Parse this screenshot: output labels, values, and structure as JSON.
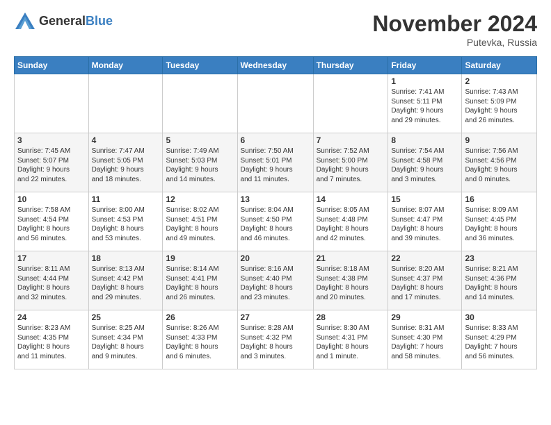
{
  "header": {
    "logo_general": "General",
    "logo_blue": "Blue",
    "month_title": "November 2024",
    "location": "Putevka, Russia"
  },
  "weekdays": [
    "Sunday",
    "Monday",
    "Tuesday",
    "Wednesday",
    "Thursday",
    "Friday",
    "Saturday"
  ],
  "weeks": [
    [
      {
        "day": "",
        "info": ""
      },
      {
        "day": "",
        "info": ""
      },
      {
        "day": "",
        "info": ""
      },
      {
        "day": "",
        "info": ""
      },
      {
        "day": "",
        "info": ""
      },
      {
        "day": "1",
        "info": "Sunrise: 7:41 AM\nSunset: 5:11 PM\nDaylight: 9 hours\nand 29 minutes."
      },
      {
        "day": "2",
        "info": "Sunrise: 7:43 AM\nSunset: 5:09 PM\nDaylight: 9 hours\nand 26 minutes."
      }
    ],
    [
      {
        "day": "3",
        "info": "Sunrise: 7:45 AM\nSunset: 5:07 PM\nDaylight: 9 hours\nand 22 minutes."
      },
      {
        "day": "4",
        "info": "Sunrise: 7:47 AM\nSunset: 5:05 PM\nDaylight: 9 hours\nand 18 minutes."
      },
      {
        "day": "5",
        "info": "Sunrise: 7:49 AM\nSunset: 5:03 PM\nDaylight: 9 hours\nand 14 minutes."
      },
      {
        "day": "6",
        "info": "Sunrise: 7:50 AM\nSunset: 5:01 PM\nDaylight: 9 hours\nand 11 minutes."
      },
      {
        "day": "7",
        "info": "Sunrise: 7:52 AM\nSunset: 5:00 PM\nDaylight: 9 hours\nand 7 minutes."
      },
      {
        "day": "8",
        "info": "Sunrise: 7:54 AM\nSunset: 4:58 PM\nDaylight: 9 hours\nand 3 minutes."
      },
      {
        "day": "9",
        "info": "Sunrise: 7:56 AM\nSunset: 4:56 PM\nDaylight: 9 hours\nand 0 minutes."
      }
    ],
    [
      {
        "day": "10",
        "info": "Sunrise: 7:58 AM\nSunset: 4:54 PM\nDaylight: 8 hours\nand 56 minutes."
      },
      {
        "day": "11",
        "info": "Sunrise: 8:00 AM\nSunset: 4:53 PM\nDaylight: 8 hours\nand 53 minutes."
      },
      {
        "day": "12",
        "info": "Sunrise: 8:02 AM\nSunset: 4:51 PM\nDaylight: 8 hours\nand 49 minutes."
      },
      {
        "day": "13",
        "info": "Sunrise: 8:04 AM\nSunset: 4:50 PM\nDaylight: 8 hours\nand 46 minutes."
      },
      {
        "day": "14",
        "info": "Sunrise: 8:05 AM\nSunset: 4:48 PM\nDaylight: 8 hours\nand 42 minutes."
      },
      {
        "day": "15",
        "info": "Sunrise: 8:07 AM\nSunset: 4:47 PM\nDaylight: 8 hours\nand 39 minutes."
      },
      {
        "day": "16",
        "info": "Sunrise: 8:09 AM\nSunset: 4:45 PM\nDaylight: 8 hours\nand 36 minutes."
      }
    ],
    [
      {
        "day": "17",
        "info": "Sunrise: 8:11 AM\nSunset: 4:44 PM\nDaylight: 8 hours\nand 32 minutes."
      },
      {
        "day": "18",
        "info": "Sunrise: 8:13 AM\nSunset: 4:42 PM\nDaylight: 8 hours\nand 29 minutes."
      },
      {
        "day": "19",
        "info": "Sunrise: 8:14 AM\nSunset: 4:41 PM\nDaylight: 8 hours\nand 26 minutes."
      },
      {
        "day": "20",
        "info": "Sunrise: 8:16 AM\nSunset: 4:40 PM\nDaylight: 8 hours\nand 23 minutes."
      },
      {
        "day": "21",
        "info": "Sunrise: 8:18 AM\nSunset: 4:38 PM\nDaylight: 8 hours\nand 20 minutes."
      },
      {
        "day": "22",
        "info": "Sunrise: 8:20 AM\nSunset: 4:37 PM\nDaylight: 8 hours\nand 17 minutes."
      },
      {
        "day": "23",
        "info": "Sunrise: 8:21 AM\nSunset: 4:36 PM\nDaylight: 8 hours\nand 14 minutes."
      }
    ],
    [
      {
        "day": "24",
        "info": "Sunrise: 8:23 AM\nSunset: 4:35 PM\nDaylight: 8 hours\nand 11 minutes."
      },
      {
        "day": "25",
        "info": "Sunrise: 8:25 AM\nSunset: 4:34 PM\nDaylight: 8 hours\nand 9 minutes."
      },
      {
        "day": "26",
        "info": "Sunrise: 8:26 AM\nSunset: 4:33 PM\nDaylight: 8 hours\nand 6 minutes."
      },
      {
        "day": "27",
        "info": "Sunrise: 8:28 AM\nSunset: 4:32 PM\nDaylight: 8 hours\nand 3 minutes."
      },
      {
        "day": "28",
        "info": "Sunrise: 8:30 AM\nSunset: 4:31 PM\nDaylight: 8 hours\nand 1 minute."
      },
      {
        "day": "29",
        "info": "Sunrise: 8:31 AM\nSunset: 4:30 PM\nDaylight: 7 hours\nand 58 minutes."
      },
      {
        "day": "30",
        "info": "Sunrise: 8:33 AM\nSunset: 4:29 PM\nDaylight: 7 hours\nand 56 minutes."
      }
    ]
  ]
}
